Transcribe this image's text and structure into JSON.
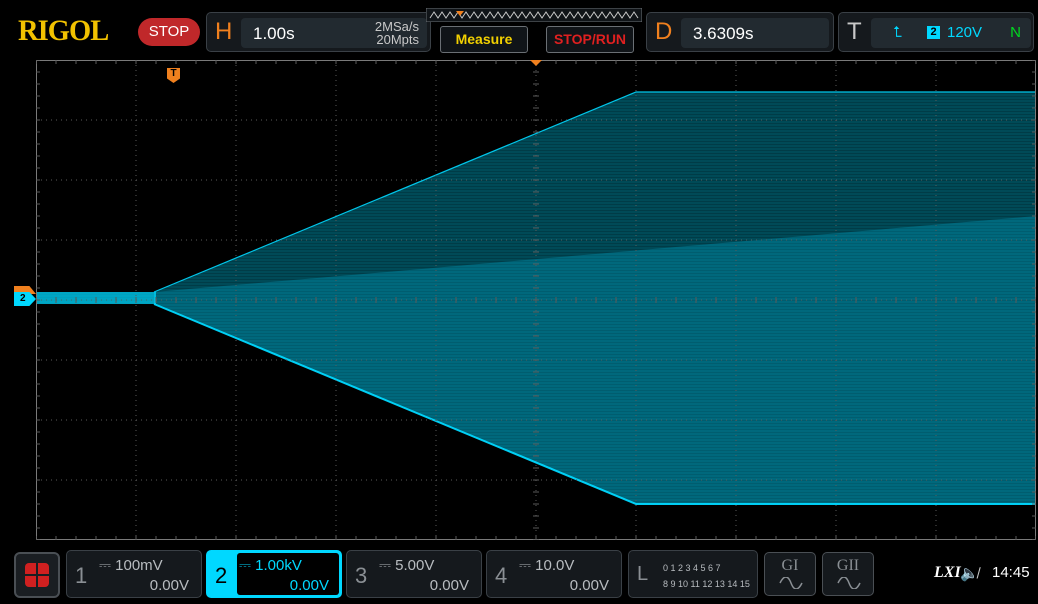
{
  "header": {
    "brand": "RIGOL",
    "run_state": "STOP",
    "horizontal": {
      "letter": "H",
      "timebase": "1.00s",
      "sample_rate": "2MSa/s",
      "memory_depth": "20Mpts"
    },
    "measure_label": "Measure",
    "stoprun_label": "STOP/RUN",
    "delay": {
      "letter": "D",
      "value": "3.6309s"
    },
    "trigger": {
      "letter": "T",
      "slope_icon": "rising-edge-icon",
      "source": "2",
      "level": "120V",
      "mode": "N"
    }
  },
  "display": {
    "trigger_marker": "T",
    "channel_marker": "2",
    "colors": {
      "channel2": "#00d8ff",
      "trigger": "#f0801e",
      "grid": "#5a5a5a"
    }
  },
  "channels": [
    {
      "number": "1",
      "coupling_icon": "dc-coupling-icon",
      "scale": "100mV",
      "offset": "0.00V",
      "active": false
    },
    {
      "number": "2",
      "coupling_icon": "dc-coupling-icon",
      "scale": "1.00kV",
      "offset": "0.00V",
      "active": true
    },
    {
      "number": "3",
      "coupling_icon": "dc-coupling-icon",
      "scale": "5.00V",
      "offset": "0.00V",
      "active": false
    },
    {
      "number": "4",
      "coupling_icon": "dc-coupling-icon",
      "scale": "10.0V",
      "offset": "0.00V",
      "active": false
    }
  ],
  "logic": {
    "letter": "L",
    "row1": "0 1 2 3  4 5 6 7",
    "row2": "8 9 10 11 12 13 14 15"
  },
  "generators": [
    {
      "label": "GI",
      "icon": "sine-wave-icon"
    },
    {
      "label": "GII",
      "icon": "sine-wave-icon"
    }
  ],
  "status": {
    "lxi": "LXI",
    "speaker_icon": "speaker-muted-icon",
    "time": "14:45"
  }
}
